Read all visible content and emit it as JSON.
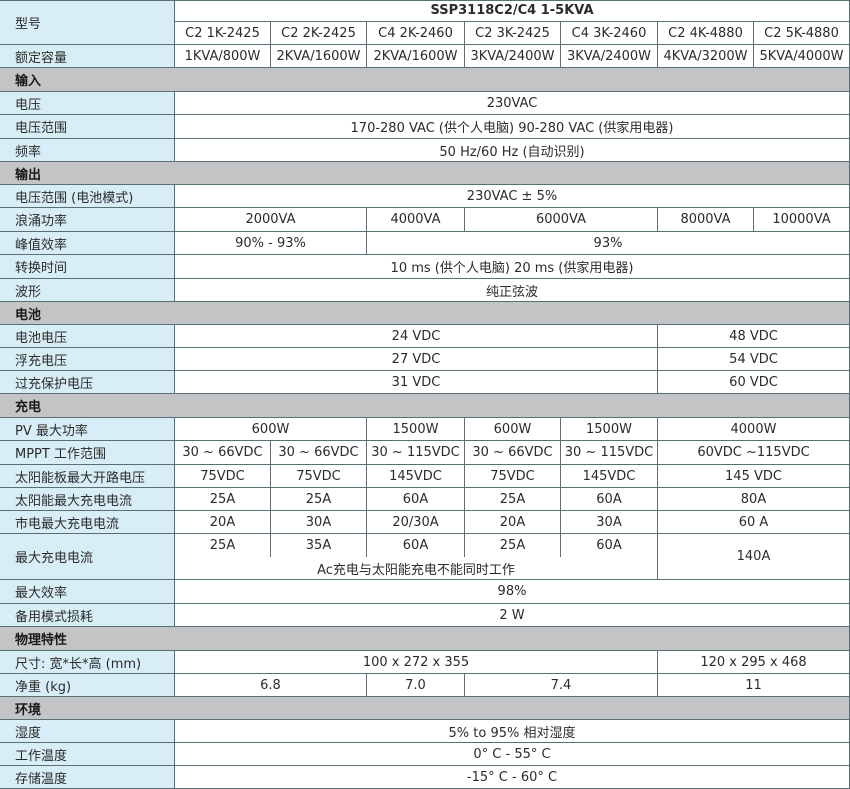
{
  "header": {
    "model_label": "型号",
    "series": "SSP3118C2/C4 1-5KVA",
    "models": [
      "C2 1K-2425",
      "C2 2K-2425",
      "C4 2K-2460",
      "C2 3K-2425",
      "C4 3K-2460",
      "C2 4K-4880",
      "C2 5K-4880"
    ]
  },
  "capacity": {
    "label": "额定容量",
    "values": [
      "1KVA/800W",
      "2KVA/1600W",
      "2KVA/1600W",
      "3KVA/2400W",
      "3KVA/2400W",
      "4KVA/3200W",
      "5KVA/4000W"
    ]
  },
  "input": {
    "section": "输入",
    "voltage_label": "电压",
    "voltage": "230VAC",
    "range_label": "电压范围",
    "range": "170-280 VAC (供个人电脑) 90-280 VAC (供家用电器)",
    "freq_label": "频率",
    "freq": "50 Hz/60 Hz (自动识别)"
  },
  "output": {
    "section": "输出",
    "battery_range_label": "电压范围 (电池模式)",
    "battery_range": "230VAC ± 5%",
    "surge_label": "浪涌功率",
    "surge": [
      "2000VA",
      "4000VA",
      "6000VA",
      "8000VA",
      "10000VA"
    ],
    "efficiency_label": "峰值效率",
    "efficiency": [
      "90% - 93%",
      "93%"
    ],
    "transfer_label": "转换时间",
    "transfer": "10 ms (供个人电脑) 20 ms (供家用电器)",
    "waveform_label": "波形",
    "waveform": "纯正弦波"
  },
  "battery": {
    "section": "电池",
    "voltage_label": "电池电压",
    "voltage": [
      "24 VDC",
      "48 VDC"
    ],
    "float_label": "浮充电压",
    "float": [
      "27 VDC",
      "54 VDC"
    ],
    "overcharge_label": "过充保护电压",
    "overcharge": [
      "31 VDC",
      "60 VDC"
    ]
  },
  "charging": {
    "section": "充电",
    "pv_power_label": "PV 最大功率",
    "pv_power": [
      "600W",
      "1500W",
      "600W",
      "1500W",
      "4000W"
    ],
    "mppt_label": "MPPT 工作范围",
    "mppt": [
      "30 ~ 66VDC",
      "30 ~ 66VDC",
      "30 ~ 115VDC",
      "30 ~ 66VDC",
      "30 ~ 115VDC",
      "60VDC ~115VDC"
    ],
    "voc_label": "太阳能板最大开路电压",
    "voc": [
      "75VDC",
      "75VDC",
      "145VDC",
      "75VDC",
      "145VDC",
      "145 VDC"
    ],
    "solar_current_label": "太阳能最大充电电流",
    "solar_current": [
      "25A",
      "25A",
      "60A",
      "25A",
      "60A",
      "80A"
    ],
    "ac_current_label": "市电最大充电电流",
    "ac_current": [
      "20A",
      "30A",
      "20/30A",
      "20A",
      "30A",
      "60 A"
    ],
    "max_current_label": "最大充电电流",
    "max_current": [
      "25A",
      "35A",
      "60A",
      "25A",
      "60A",
      "140A"
    ],
    "max_current_note": "Ac充电与太阳能充电不能同时工作",
    "max_eff_label": "最大效率",
    "max_eff": "98%",
    "standby_label": "备用模式损耗",
    "standby": "2 W"
  },
  "physical": {
    "section": "物理特性",
    "dims_label": "尺寸: 宽*长*高 (mm)",
    "dims": [
      "100 x 272 x 355",
      "120 x 295 x 468"
    ],
    "weight_label": "净重 (kg)",
    "weight": [
      "6.8",
      "7.0",
      "7.4",
      "11"
    ]
  },
  "environment": {
    "section": "环境",
    "humidity_label": "湿度",
    "humidity": "5% to 95% 相对湿度",
    "op_temp_label": "工作温度",
    "op_temp": "0° C - 55° C",
    "storage_temp_label": "存储温度",
    "storage_temp": "-15° C - 60° C"
  }
}
